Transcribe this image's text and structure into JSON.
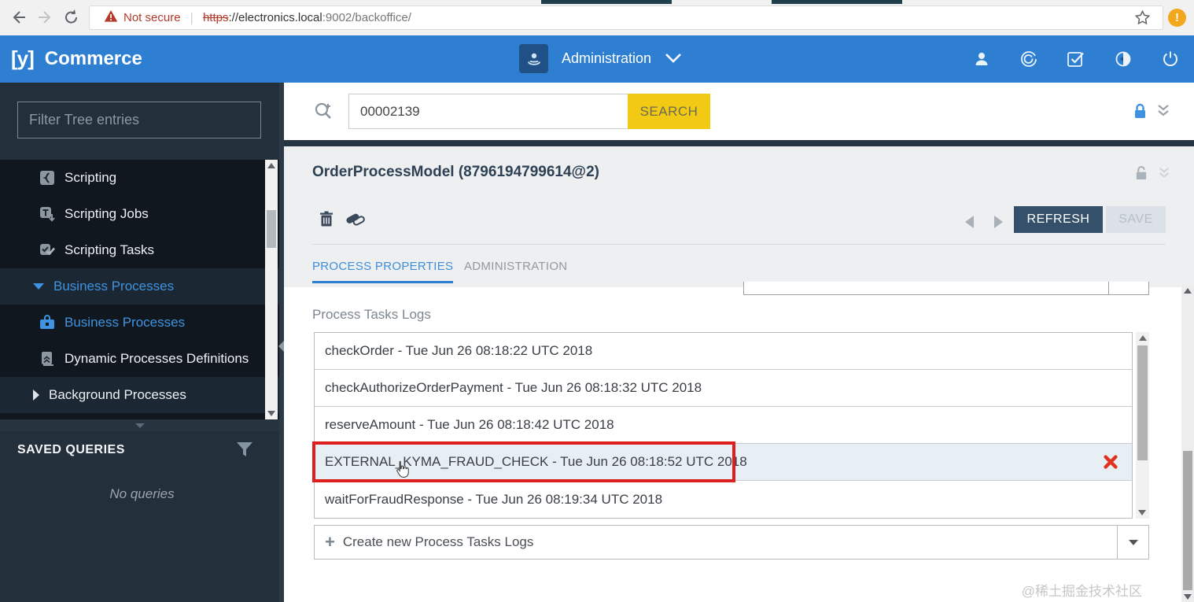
{
  "browser": {
    "not_secure": "Not secure",
    "scheme": "https",
    "host": "://electronics.local",
    "path": ":9002/backoffice/"
  },
  "appbar": {
    "brand_logo": "[y]",
    "brand": "Commerce",
    "perspective": "Administration"
  },
  "sidebar": {
    "filter_placeholder": "Filter Tree entries",
    "tree": [
      {
        "label": "Scripting",
        "icon": "script-icon",
        "kind": "item"
      },
      {
        "label": "Scripting Jobs",
        "icon": "script-jobs-icon",
        "kind": "item"
      },
      {
        "label": "Scripting Tasks",
        "icon": "script-tasks-icon",
        "kind": "item"
      },
      {
        "label": "Business Processes",
        "kind": "group",
        "expanded": true,
        "blue": true
      },
      {
        "label": "Business Processes",
        "icon": "briefcase-icon",
        "kind": "item",
        "blue": true
      },
      {
        "label": "Dynamic Processes Definitions",
        "icon": "scroll-icon",
        "kind": "item"
      },
      {
        "label": "Background Processes",
        "kind": "group",
        "expanded": false
      }
    ],
    "saved_queries": {
      "title": "SAVED QUERIES",
      "empty": "No queries"
    }
  },
  "search": {
    "value": "00002139",
    "button": "SEARCH"
  },
  "editor": {
    "title": "OrderProcessModel (8796194799614@2)",
    "refresh": "REFRESH",
    "save": "SAVE",
    "tabs": [
      {
        "label": "PROCESS PROPERTIES",
        "active": true
      },
      {
        "label": "ADMINISTRATION",
        "active": false
      }
    ],
    "section_label": "Process Tasks Logs",
    "logs": [
      {
        "text": "checkOrder - Tue Jun 26 08:18:22 UTC 2018"
      },
      {
        "text": "checkAuthorizeOrderPayment - Tue Jun 26 08:18:32 UTC 2018"
      },
      {
        "text": "reserveAmount - Tue Jun 26 08:18:42 UTC 2018"
      },
      {
        "text": "EXTERNAL_KYMA_FRAUD_CHECK - Tue Jun 26 08:18:52 UTC 2018",
        "selected": true,
        "annotated": true
      },
      {
        "text": "waitForFraudResponse - Tue Jun 26 08:19:34 UTC 2018"
      }
    ],
    "create_label": "Create new Process Tasks Logs",
    "plus": "+"
  },
  "watermark": "@稀土掘金技术社区",
  "colors": {
    "appbar_blue": "#2e7fd2",
    "accent_blue": "#3f93e0",
    "search_yellow": "#f2ca13",
    "refresh_navy": "#35506b",
    "annotation_red": "#de1f1f",
    "sidebar_dark": "#232f3a"
  }
}
